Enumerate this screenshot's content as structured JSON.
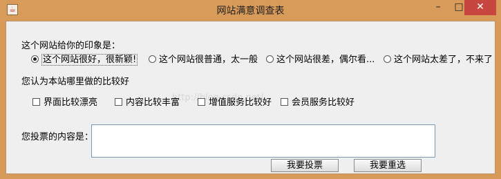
{
  "window": {
    "title": "网站满意调查表",
    "minimize": "–",
    "maximize": "□",
    "close": "✕",
    "app_icon": "java-cup-icon"
  },
  "impression": {
    "label": "这个网站给你的印象是：",
    "options": [
      "这个网站很好，很新颖!",
      "这个网站很普通，太一般",
      "这个网站很差，偶尔看...",
      "这个网站太差了，不来了"
    ],
    "selected_index": 0
  },
  "highlights": {
    "label": "您认为本站哪里做的比较好",
    "options": [
      "界面比较漂亮",
      "内容比较丰富",
      "增值服务比较好",
      "会员服务比较好"
    ],
    "checked": [
      false,
      false,
      false,
      false
    ]
  },
  "vote": {
    "label": "您投票的内容是：",
    "content": ""
  },
  "buttons": {
    "vote": "我要投票",
    "reset": "我要重选"
  },
  "watermark": "http://blog.csdn.net/"
}
